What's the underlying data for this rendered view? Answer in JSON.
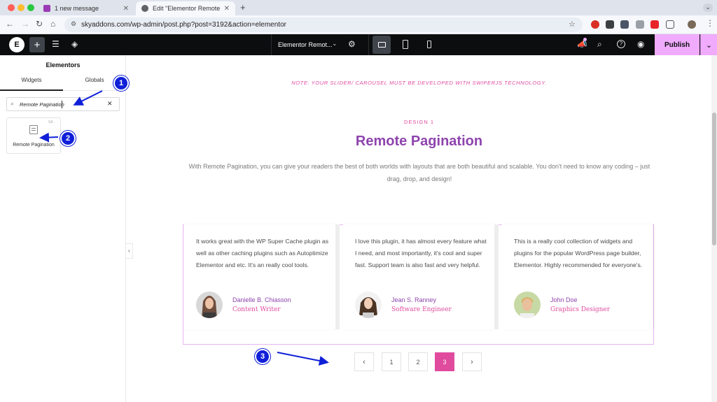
{
  "browser": {
    "tabs": [
      {
        "title": "1 new message",
        "favicon_color": "#9b3bb5"
      },
      {
        "title": "Edit \"Elementor Remote Pagi...",
        "favicon_color": "#5f6368"
      }
    ],
    "new_tab": "+",
    "url": "skyaddons.com/wp-admin/post.php?post=3192&action=elementor"
  },
  "editor": {
    "page_name": "Elementor Remot...",
    "publish_label": "Publish"
  },
  "panel": {
    "title": "Elementors",
    "tabs": [
      "Widgets",
      "Globals"
    ],
    "search_value": "Remote Pagination",
    "widget": {
      "label": "Remote Pagination",
      "badge": "SA"
    }
  },
  "canvas": {
    "note": "NOTE: YOUR SLIDER/ CAROUSEL MUST BE DEVELOPED WITH SWIPERJS TECHNOLOGY.",
    "subtitle": "DESIGN 1",
    "heading": "Remote Pagination",
    "description": "With Remote Pagination, you can give your readers the best of both worlds with layouts that are both beautiful and scalable. You don't need to know any coding – just drag, drop, and design!",
    "cards": [
      {
        "text": "It works great with the WP Super Cache plugin as well as other caching plugins such as Autoptimize Elementor and etc. It's an really cool tools.",
        "name": "Danielle B. Chiasson",
        "role": "Content Writer"
      },
      {
        "text": "I love this plugin, it has almost every feature what I need, and most importantly, it's cool and super fast. Support team is also fast and very helpful.",
        "name": "Jean S. Ranney",
        "role": "Software Engineer"
      },
      {
        "text": "This is a really cool collection of widgets and plugins for the popular WordPress page builder, Elementor. Highly recommended for everyone's.",
        "name": "John Doe",
        "role": "Graphics Designer"
      }
    ],
    "pagination": {
      "pages": [
        "1",
        "2",
        "3"
      ],
      "active": "3"
    }
  },
  "annotations": [
    "1",
    "2",
    "3"
  ],
  "colors": {
    "accent_purple": "#8e44ad",
    "accent_pink": "#e04b9e",
    "publish_bg": "#f0abfc",
    "annotation_blue": "#1020d8"
  }
}
